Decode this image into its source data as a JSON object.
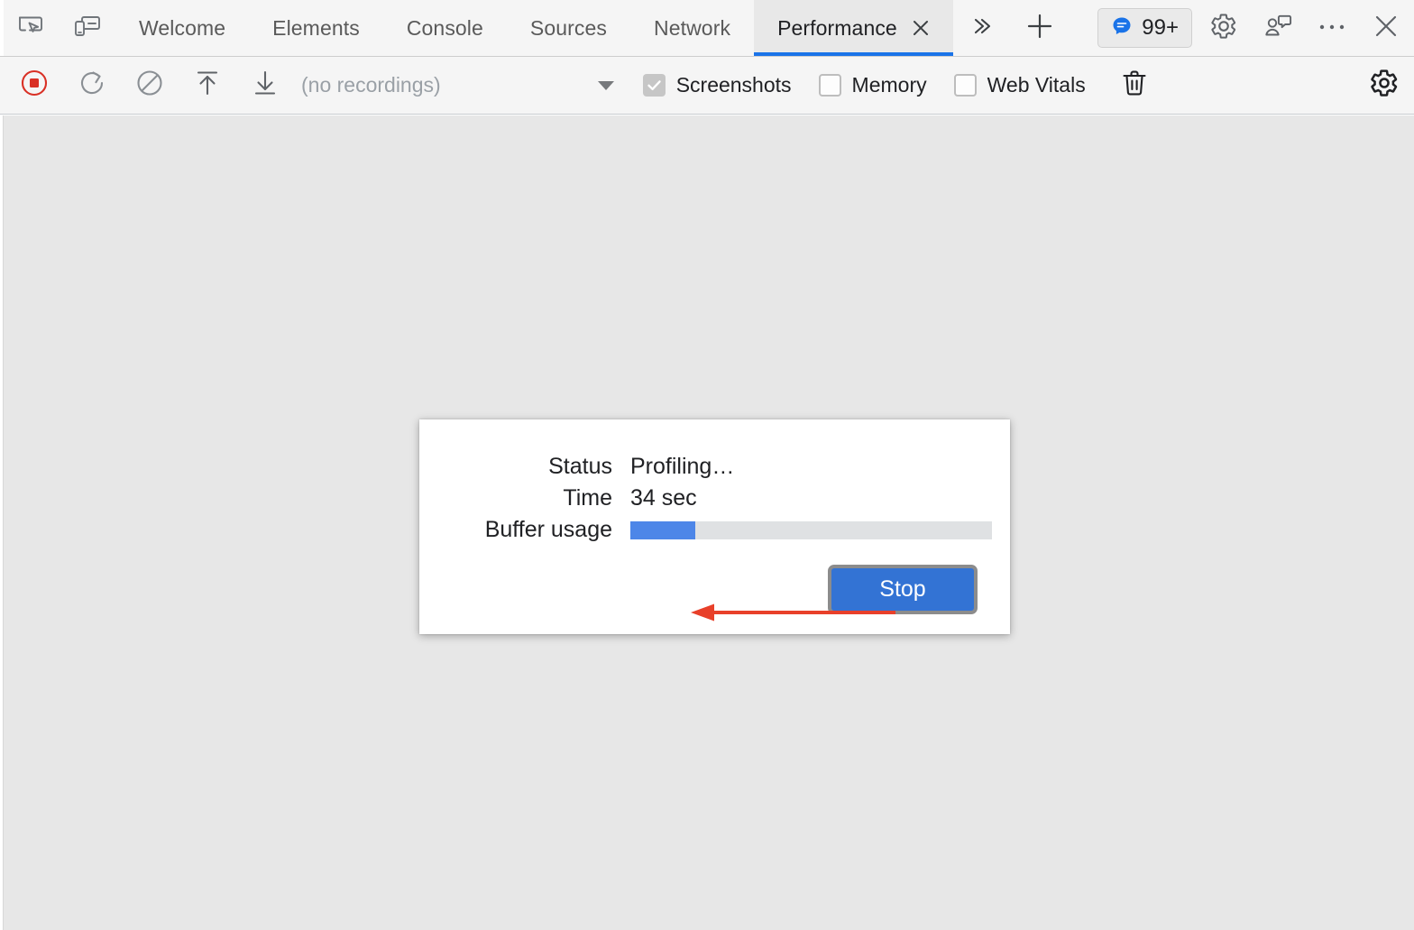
{
  "window": {
    "title": "DevTools - Performance"
  },
  "tabbar": {
    "inspect_icon": "inspect-element-icon",
    "device_icon": "device-toolbar-icon",
    "tabs": [
      {
        "label": "Welcome",
        "active": false
      },
      {
        "label": "Elements",
        "active": false
      },
      {
        "label": "Console",
        "active": false
      },
      {
        "label": "Sources",
        "active": false
      },
      {
        "label": "Network",
        "active": false
      },
      {
        "label": "Performance",
        "active": true
      }
    ],
    "active_tab_close_icon": "close-icon",
    "more_tabs_icon": "chevron-double-right-icon",
    "add_tab_icon": "plus-icon",
    "issues": {
      "icon": "issues-speech-bubble-icon",
      "count": "99+",
      "accent": "#1a73e8"
    },
    "settings_icon": "gear-icon",
    "feedback_icon": "feedback-person-icon",
    "more_options_icon": "three-dots-icon",
    "close_icon": "close-icon"
  },
  "controls": {
    "record_button": {
      "icon": "record-stop-icon",
      "label": "Stop profiling",
      "color": "#d93025",
      "recording": true
    },
    "reload_icon": "reload-and-record-icon",
    "clear_icon": "clear-recording-icon",
    "load_icon": "load-profile-icon",
    "save_icon": "save-profile-icon",
    "recordings_dropdown": {
      "value": "(no recordings)",
      "caret_icon": "caret-down-icon",
      "disabled": true
    },
    "checkboxes": [
      {
        "label": "Screenshots",
        "checked": true,
        "disabled": true
      },
      {
        "label": "Memory",
        "checked": false,
        "disabled": false
      },
      {
        "label": "Web Vitals",
        "checked": false,
        "disabled": false
      }
    ],
    "trash_icon": "trash-icon",
    "capture_settings_icon": "gear-icon"
  },
  "status_dialog": {
    "rows": [
      {
        "label": "Status",
        "value": "Profiling…"
      },
      {
        "label": "Time",
        "value": "34 sec"
      },
      {
        "label": "Buffer usage",
        "value": ""
      }
    ],
    "buffer": {
      "percent": 18,
      "fill_color": "#4d86e8",
      "track_color": "#dfe1e3"
    },
    "stop_button": {
      "label": "Stop",
      "color": "#3373d4"
    }
  },
  "annotation": {
    "arrow": {
      "points_to": "34 sec",
      "color": "#e8402a",
      "direction": "left"
    }
  }
}
